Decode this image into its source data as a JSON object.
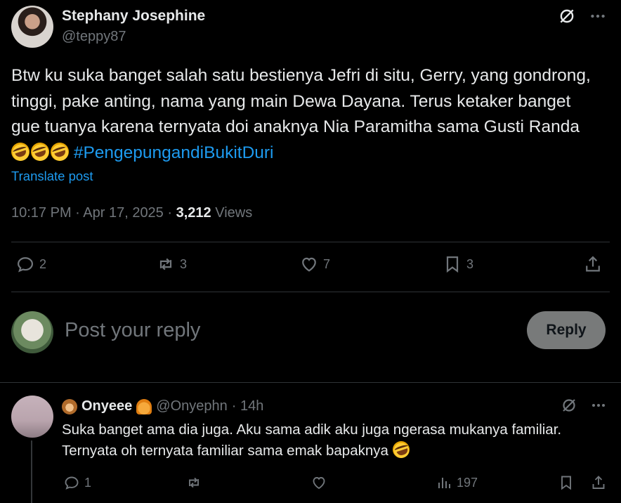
{
  "post": {
    "author": {
      "name": "Stephany Josephine",
      "handle": "@teppy87"
    },
    "text_main": "Btw ku suka banget salah satu bestienya Jefri di situ, Gerry, yang gondrong, tinggi, pake anting, nama yang main Dewa Dayana. Terus ketaker banget gue tuanya karena ternyata doi anaknya Nia Paramitha sama Gusti Randa",
    "hashtag": "#PengepungandiBukitDuri",
    "translate_label": "Translate post",
    "time": "10:17 PM · Apr 17, 2025 · ",
    "views_count": "3,212",
    "views_label": " Views",
    "actions": {
      "replies": "2",
      "reposts": "3",
      "likes": "7",
      "bookmarks": "3"
    },
    "icons": [
      "grok-icon",
      "more-icon",
      "reply-icon",
      "repost-icon",
      "like-icon",
      "bookmark-icon",
      "share-icon"
    ]
  },
  "reply_box": {
    "placeholder": "Post your reply",
    "button_label": "Reply"
  },
  "reply": {
    "name": "Onyeee",
    "handle": "@Onyephn",
    "time": "· 14h",
    "text": "Suka banget ama dia juga. Aku sama adik aku juga ngerasa mukanya familiar. Ternyata oh ternyata familiar sama emak bapaknya",
    "actions": {
      "replies": "1",
      "reposts": "",
      "likes": "",
      "views": "197"
    }
  },
  "colors": {
    "background": "#000000",
    "text": "#e7e9ea",
    "muted": "#71767b",
    "accent": "#1d9bf0",
    "divider": "#2f3336",
    "reply_button": "#787a7a"
  }
}
